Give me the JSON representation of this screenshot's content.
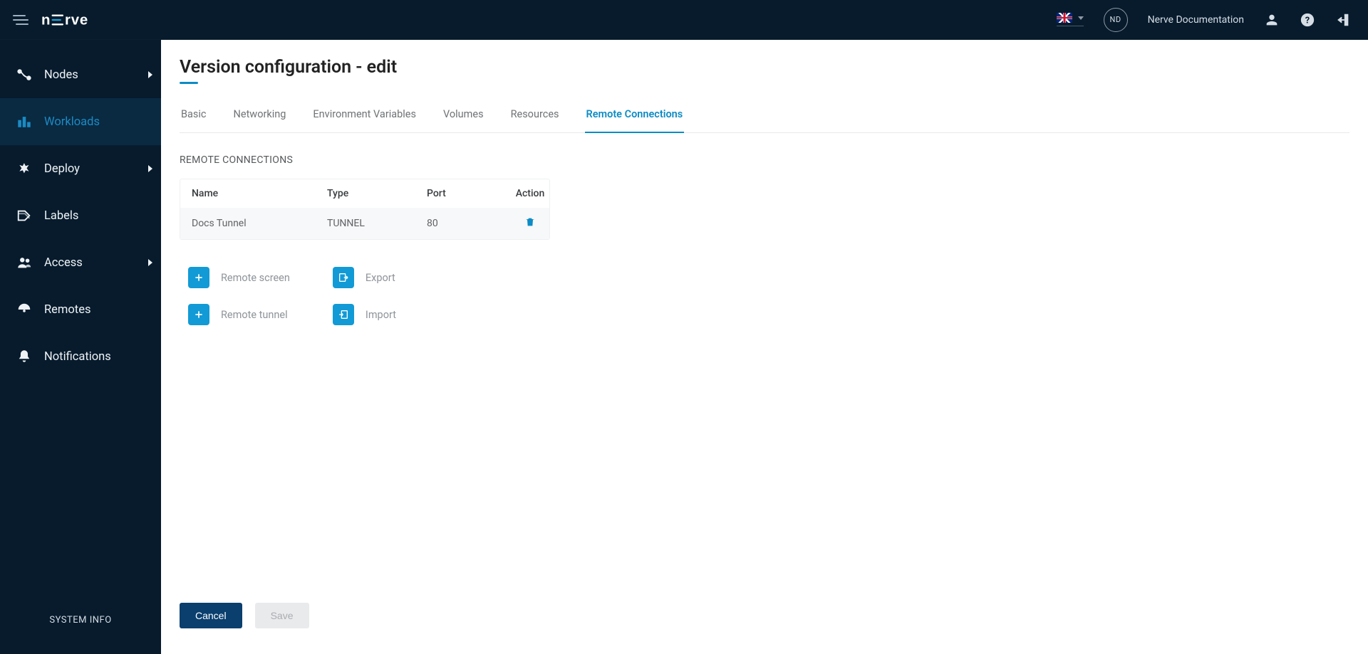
{
  "header": {
    "user_initials": "ND",
    "user_label": "Nerve Documentation"
  },
  "sidebar": {
    "items": [
      {
        "label": "Nodes",
        "expandable": true
      },
      {
        "label": "Workloads",
        "expandable": false
      },
      {
        "label": "Deploy",
        "expandable": true
      },
      {
        "label": "Labels",
        "expandable": false
      },
      {
        "label": "Access",
        "expandable": true
      },
      {
        "label": "Remotes",
        "expandable": false
      },
      {
        "label": "Notifications",
        "expandable": false
      }
    ],
    "system_info": "SYSTEM INFO"
  },
  "main": {
    "title": "Version configuration - edit",
    "tabs": [
      "Basic",
      "Networking",
      "Environment Variables",
      "Volumes",
      "Resources",
      "Remote Connections"
    ],
    "active_tab": "Remote Connections",
    "section_label": "REMOTE CONNECTIONS",
    "table": {
      "headers": {
        "name": "Name",
        "type": "Type",
        "port": "Port",
        "action": "Action"
      },
      "rows": [
        {
          "name": "Docs Tunnel",
          "type": "TUNNEL",
          "port": "80"
        }
      ]
    },
    "actions": {
      "remote_screen": "Remote screen",
      "remote_tunnel": "Remote tunnel",
      "export": "Export",
      "import": "Import"
    },
    "buttons": {
      "cancel": "Cancel",
      "save": "Save"
    }
  }
}
